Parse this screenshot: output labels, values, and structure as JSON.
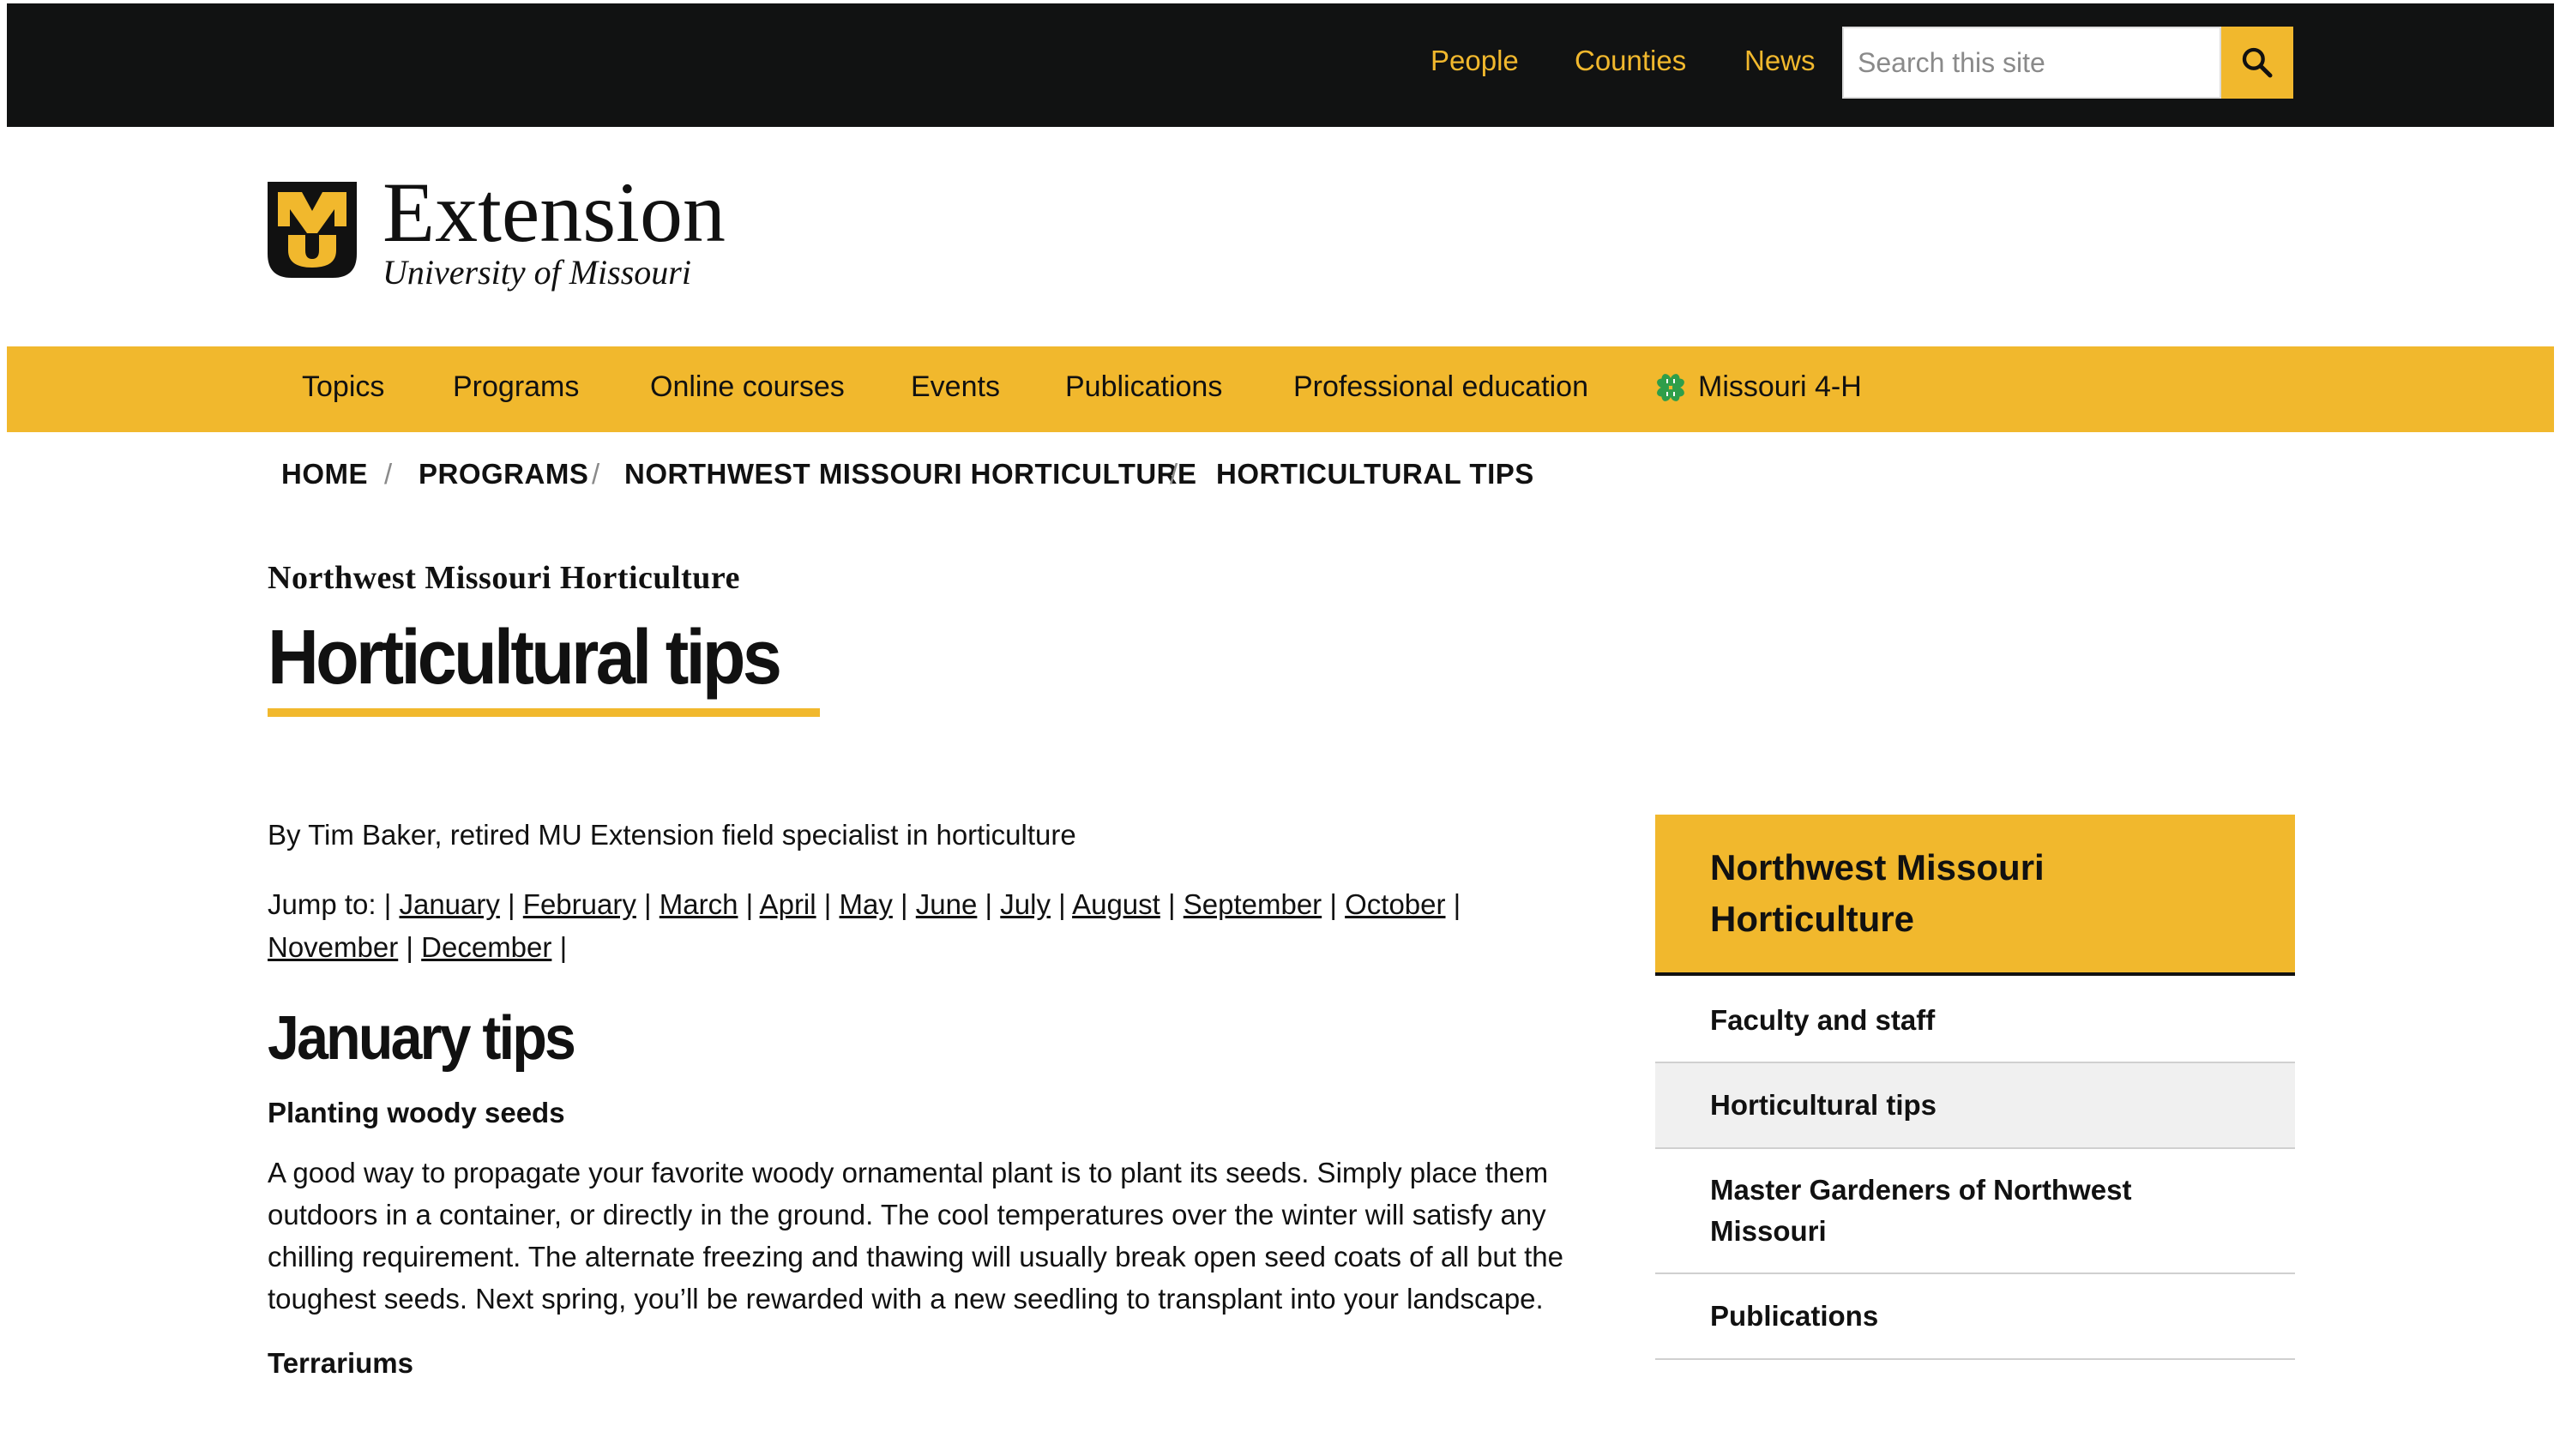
{
  "topnav": {
    "links": [
      "People",
      "Counties",
      "News"
    ],
    "search_placeholder": "Search this site"
  },
  "logo": {
    "wordmark": "Extension",
    "subtitle": "University of Missouri",
    "monogram": "MU"
  },
  "mainnav": {
    "items": [
      "Topics",
      "Programs",
      "Online courses",
      "Events",
      "Publications",
      "Professional education",
      "Missouri 4-H"
    ]
  },
  "breadcrumb": [
    "HOME",
    "PROGRAMS",
    "NORTHWEST MISSOURI HORTICULTURE",
    "HORTICULTURAL TIPS"
  ],
  "page": {
    "kicker": "Northwest Missouri Horticulture",
    "title": "Horticultural tips",
    "byline": "By Tim Baker, retired MU Extension field specialist in horticulture",
    "jump_label": "Jump to: |",
    "months": [
      "January",
      "February",
      "March",
      "April",
      "May",
      "June",
      "July",
      "August",
      "September",
      "October",
      "November",
      "December"
    ],
    "section_title": "January tips",
    "subhead1": "Planting woody seeds",
    "paragraph1": "A good way to propagate your favorite woody ornamental plant is to plant its seeds. Simply place them outdoors in a container, or directly in the ground. The cool temperatures over the winter will satisfy any chilling requirement. The alternate freezing and thawing will usually break open seed coats of all but the toughest seeds. Next spring, you’ll be rewarded with a new seedling to transplant into your landscape.",
    "subhead2": "Terrariums"
  },
  "sidebar": {
    "heading_line1": "Northwest Missouri",
    "heading_line2": "Horticulture",
    "items": [
      "Faculty and staff",
      "Horticultural tips",
      "Master Gardeners of Northwest Missouri",
      "Publications"
    ]
  },
  "colors": {
    "gold": "#f1b82d",
    "black": "#111212",
    "fourh_green": "#2e9e4a"
  }
}
